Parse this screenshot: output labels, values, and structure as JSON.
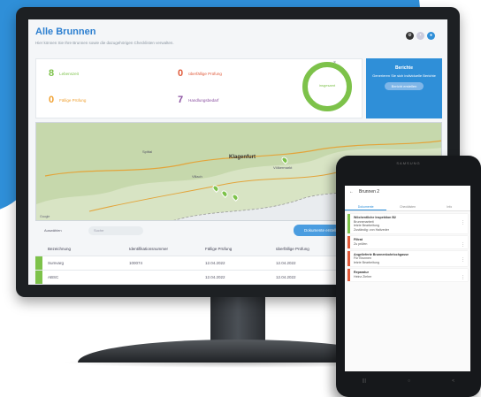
{
  "app": {
    "title": "Alle Brunnen",
    "subtitle": "Hier können Sie Ihre Brunnen sowie die dazugehörigen Checklisten verwalten."
  },
  "stats": [
    {
      "value": "8",
      "label": "Lebenszeit",
      "color": "#7dc24a"
    },
    {
      "value": "0",
      "label": "überfällige Prüfung",
      "color": "#e05a3a"
    },
    {
      "value": "0",
      "label": "Fällige Prüfung",
      "color": "#f0a030"
    },
    {
      "value": "7",
      "label": "Handlungsbedarf",
      "color": "#8a4fa0"
    }
  ],
  "donut": {
    "label": "insgesamt",
    "close": "×"
  },
  "reports": {
    "title": "Berichte",
    "text": "Generieren Sie sich individuelle Berichte",
    "button": "Bericht erstellen"
  },
  "map": {
    "cities": [
      "Klagenfurt",
      "Villach",
      "Völkermarkt",
      "Spittal"
    ],
    "copyright": "Google"
  },
  "toolbar": {
    "select": "Auswählen",
    "search_placeholder": "Suche",
    "button": "Dokumente erstellen"
  },
  "table": {
    "headers": [
      "Bezeichnung",
      "Identifikationsnummer",
      "Fällige Prüfung",
      "überfällige Prüfung"
    ],
    "rows": [
      [
        "Sumvarg",
        "100074",
        "12.04.2022",
        "12.04.2022"
      ],
      [
        "ABSC",
        "",
        "12.04.2022",
        "12.04.2022"
      ]
    ]
  },
  "tablet": {
    "brand": "SAMSUNG",
    "header": "Brunnen 2",
    "tabs": [
      "Dokumente",
      "Checklisten",
      "Info"
    ],
    "cards": [
      {
        "title": "Wöchentliche Inspektion B2",
        "lines": [
          "Brunnenarbeit",
          "letzte Bearbeitung",
          "Zuständig: von Haitzeder"
        ],
        "color": "#7dc24a"
      },
      {
        "title": "Filtrat",
        "lines": [
          "Zu prüfen"
        ],
        "color": "#e05a3a"
      },
      {
        "title": "Angelieferte Brunnenbohrlochgasse",
        "lines": [
          "Für Brunnen",
          "letzte Bearbeitung"
        ],
        "color": "#e05a3a"
      },
      {
        "title": "Reparatur",
        "lines": [
          "Heinz Zieher"
        ],
        "color": "#e05a3a"
      }
    ],
    "nav": [
      "|||",
      "○",
      "<"
    ]
  }
}
